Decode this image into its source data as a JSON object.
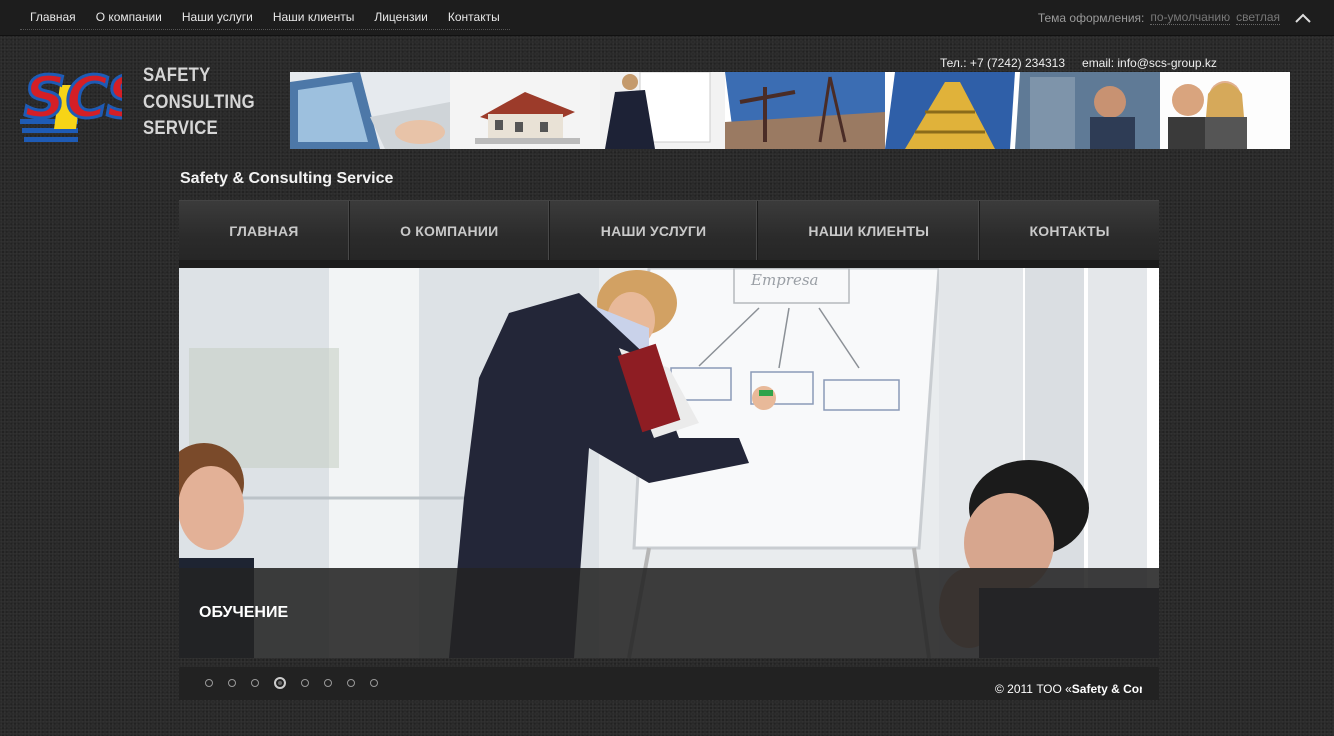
{
  "top_nav": [
    "Главная",
    "О компании",
    "Наши услуги",
    "Наши клиенты",
    "Лицензии",
    "Контакты"
  ],
  "theme_switcher": {
    "label": "Тема оформления:",
    "options": [
      "по-умолчанию",
      "светлая"
    ]
  },
  "logo": {
    "mark": "SCS",
    "lines": [
      "SAFETY",
      "CONSULTING",
      "SERVICE"
    ]
  },
  "contacts": {
    "phone": "Тел.: +7 (7242) 234313",
    "email": "email: info@scs-group.kz"
  },
  "site_title": "Safety & Consulting Service",
  "main_nav": [
    "ГЛАВНАЯ",
    "О КОМПАНИИ",
    "НАШИ УСЛУГИ",
    "НАШИ КЛИЕНТЫ",
    "КОНТАКТЫ"
  ],
  "slider": {
    "caption": "ОБУЧЕНИЕ",
    "board_text": "Empresa",
    "slide_count": 8,
    "active_slide": 4
  },
  "footer": {
    "copyright_prefix": "© 2011 ТОО «",
    "copyright_name": "Safety & Consulting Service"
  },
  "colors": {
    "background": "#2a2a2a",
    "topbar": "#1d1d1d",
    "nav": "#333333",
    "logo_red": "#d41f26",
    "logo_blue": "#1e5bb5",
    "logo_yellow": "#f7d417"
  }
}
